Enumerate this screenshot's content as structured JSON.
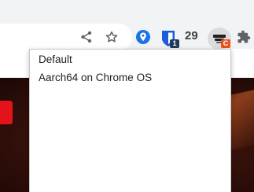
{
  "toolbar": {
    "icons": [
      "share-icon",
      "star-icon",
      "location-pin-icon",
      "bitwarden-icon",
      "ublock-icon",
      "puzzle-icon"
    ],
    "bitwarden_badge": "1",
    "count_label": "29",
    "ublock_badge": "C"
  },
  "menu": {
    "items": [
      {
        "label": "Default"
      },
      {
        "label": "Aarch64 on Chrome OS"
      }
    ]
  },
  "colors": {
    "toolbar_bg": "#f1f3f4",
    "pin_blue": "#1a73e8",
    "bitwarden_blue": "#175ddc",
    "ublock_badge": "#e8531c",
    "hero_red": "#e3131b"
  }
}
